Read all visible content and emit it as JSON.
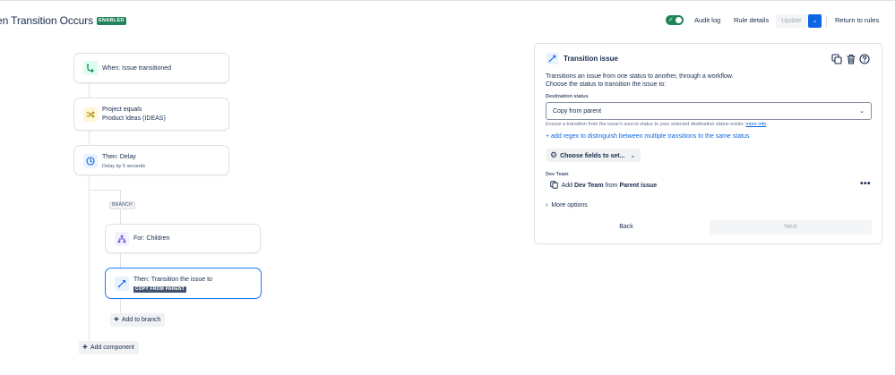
{
  "header": {
    "title": "en Transition Occurs",
    "status_badge": "ENABLED",
    "toggle_on": true,
    "audit_log": "Audit log",
    "rule_details": "Rule details",
    "update": "Update",
    "return_to_rules": "Return to rules"
  },
  "flow": {
    "trigger": {
      "label": "When: Issue transitioned",
      "icon": "transition-trigger-icon"
    },
    "condition": {
      "line1": "Project equals",
      "line2": "Product Ideas (IDEAS)",
      "icon": "shuffle-icon"
    },
    "delay": {
      "title": "Then: Delay",
      "subtitle": "Delay by 5 seconds",
      "icon": "clock-icon"
    },
    "branch_label": "BRANCH",
    "branch_for": {
      "label": "For: Children",
      "icon": "hierarchy-icon"
    },
    "branch_action": {
      "title": "Then: Transition the issue to",
      "lozenge": "COPY FROM PARENT",
      "icon": "transition-icon"
    },
    "add_to_branch": "Add to branch",
    "add_component": "Add component"
  },
  "panel": {
    "title": "Transition issue",
    "description_line1": "Transitions an issue from one status to another, through a workflow.",
    "description_line2": "Choose the status to transition the issue to:",
    "destination_label": "Destination status",
    "destination_value": "Copy from parent",
    "help_text": "Ensure a transition from the issue's source status to your selected destination status exists;",
    "help_link": "more info",
    "regex_link": "+ add regex to distinguish between multiple transitions to the same status",
    "choose_fields": "Choose fields to set...",
    "field_label": "Dev Team",
    "field_row": {
      "prefix": "Add",
      "field": "Dev Team",
      "middle": "from",
      "source": "Parent issue"
    },
    "more_options": "More options",
    "back": "Back",
    "next": "Next"
  },
  "colors": {
    "accent": "#0c66e4",
    "enabled_green": "#1f845a",
    "selected_border": "#1d7afc"
  }
}
